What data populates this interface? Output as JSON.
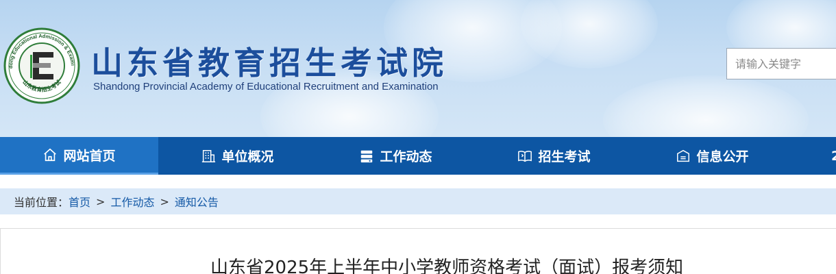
{
  "header": {
    "logo_ring_text": "Shandong Educational Admission & Examination",
    "logo_ring_text_cn": "山东教育招生考试",
    "logo_letter": "E",
    "title_cn": "山东省教育招生考试院",
    "title_en": "Shandong Provincial Academy of Educational Recruitment and Examination",
    "search_placeholder": "请输入关键字"
  },
  "nav": {
    "items": [
      {
        "label": "网站首页",
        "icon": "home-icon",
        "active": true
      },
      {
        "label": "单位概况",
        "icon": "building-icon"
      },
      {
        "label": "工作动态",
        "icon": "news-icon"
      },
      {
        "label": "招生考试",
        "icon": "book-icon"
      },
      {
        "label": "信息公开",
        "icon": "info-icon"
      },
      {
        "label": "2"
      }
    ]
  },
  "breadcrumb": {
    "prefix": "当前位置：",
    "items": [
      "首页",
      "工作动态",
      "通知公告"
    ],
    "separator": ">"
  },
  "article": {
    "title": "山东省2025年上半年中小学教师资格考试（面试）报考须知"
  },
  "colors": {
    "nav_bg": "#0d56a3",
    "nav_active": "#1f72c4",
    "title_blue": "#1c4e9c",
    "breadcrumb_bg": "#dbe9f8",
    "link": "#1459a6"
  }
}
